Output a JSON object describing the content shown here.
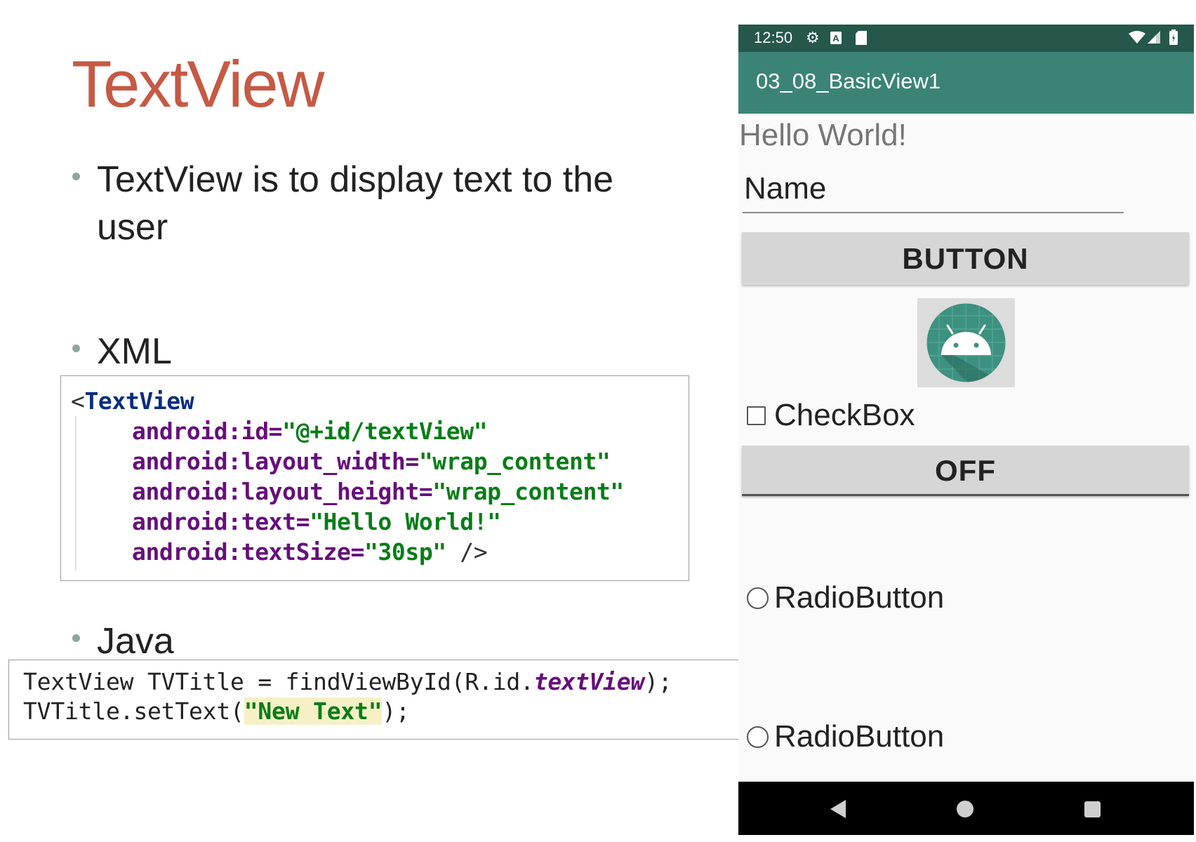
{
  "slide": {
    "title": "TextView",
    "bullets": [
      {
        "line1": "TextView is to display text to the",
        "line2": "user"
      },
      {
        "line1": "XML"
      },
      {
        "line1": "Java"
      }
    ],
    "xml_code": {
      "open_bracket": "<",
      "tag": "TextView",
      "lines": [
        {
          "attr": "android:id=",
          "value": "\"@+id/textView\"",
          "tail": ""
        },
        {
          "attr": "android:layout_width=",
          "value": "\"wrap_content\"",
          "tail": ""
        },
        {
          "attr": "android:layout_height=",
          "value": "\"wrap_content\"",
          "tail": ""
        },
        {
          "attr": "android:text=",
          "value": "\"Hello World!\"",
          "tail": ""
        },
        {
          "attr": "android:textSize=",
          "value": "\"30sp\"",
          "tail": " />"
        }
      ]
    },
    "java_code": {
      "line1_pre": "TextView TVTitle = findViewById(R.id.",
      "line1_field": "textView",
      "line1_post": ");",
      "line2_pre": "TVTitle.setText(",
      "line2_string": "\"New Text\"",
      "line2_post": ");"
    }
  },
  "phone": {
    "status_bar": {
      "time": "12:50",
      "icons": [
        "gear-icon",
        "a-icon",
        "sd-card-icon",
        "wifi-icon",
        "signal-icon",
        "battery-icon"
      ]
    },
    "app_bar": {
      "title": "03_08_BasicView1"
    },
    "text_view": "Hello World!",
    "edit_text": {
      "value": "Name"
    },
    "button": {
      "label": "BUTTON"
    },
    "image_view": {
      "icon": "android-logo-icon"
    },
    "checkbox": {
      "label": "CheckBox",
      "checked": false
    },
    "toggle_button": {
      "label": "OFF"
    },
    "radio_buttons": [
      {
        "label": "RadioButton",
        "checked": false
      },
      {
        "label": "RadioButton",
        "checked": false
      }
    ],
    "nav_bar": {
      "icons": [
        "back-icon",
        "home-icon",
        "recents-icon"
      ]
    },
    "colors": {
      "status_bar": "#25574a",
      "app_bar": "#3b8475",
      "title_accent": "#c55a45"
    }
  }
}
